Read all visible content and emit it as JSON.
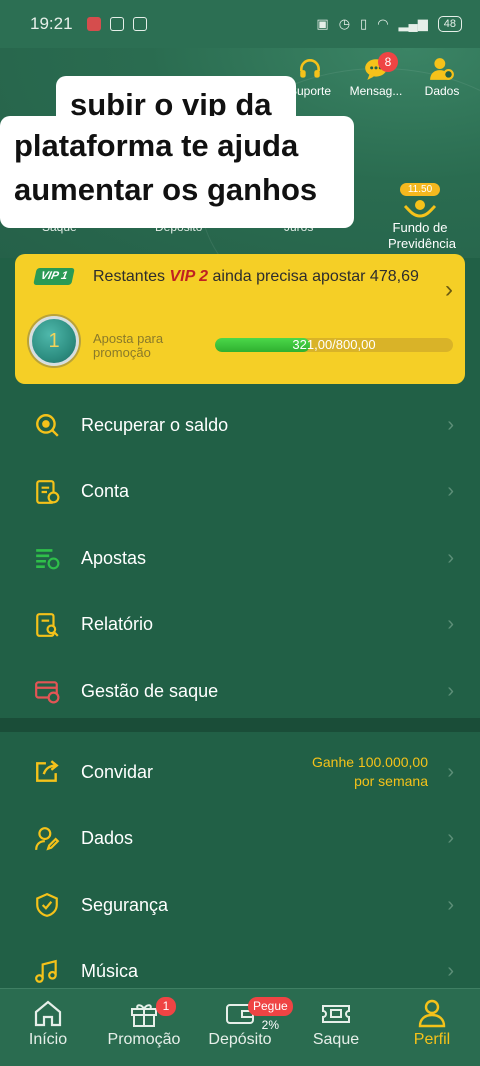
{
  "status_bar": {
    "time": "19:21",
    "battery": "48"
  },
  "header": {
    "actions": [
      {
        "label": "Suporte",
        "icon": "headset-icon"
      },
      {
        "label": "Mensag...",
        "icon": "chat-bubble-icon",
        "badge": "8"
      },
      {
        "label": "Dados",
        "icon": "user-settings-icon"
      }
    ],
    "quick_links": [
      "Saque",
      "Depósito",
      "Juros"
    ],
    "fundo": {
      "pill": "11.50",
      "label": "Fundo de Previdência"
    }
  },
  "overlay_caption": [
    "subir o vip da",
    "plataforma te ajuda",
    "aumentar os ganhos"
  ],
  "vip": {
    "tag": "VIP 1",
    "text_prefix": "Restantes",
    "next_level": "VIP 2",
    "text_suffix": "ainda precisa apostar 478,69",
    "level": "1",
    "promo_label": "Aposta para promoção",
    "progress_text": "321,00/800,00",
    "progress_fraction": 0.40125
  },
  "menu_group_1": [
    {
      "label": "Recuperar o saldo",
      "icon": "coin-refresh-icon"
    },
    {
      "label": "Conta",
      "icon": "account-document-icon"
    },
    {
      "label": "Apostas",
      "icon": "bet-list-icon"
    },
    {
      "label": "Relatório",
      "icon": "report-search-icon"
    },
    {
      "label": "Gestão de saque",
      "icon": "card-withdraw-icon"
    }
  ],
  "menu_group_2": [
    {
      "label": "Convidar",
      "icon": "share-icon",
      "promo_line1": "Ganhe 100.000,00",
      "promo_line2": "por semana"
    },
    {
      "label": "Dados",
      "icon": "user-edit-icon"
    },
    {
      "label": "Segurança",
      "icon": "shield-check-icon"
    },
    {
      "label": "Música",
      "icon": "music-note-icon"
    }
  ],
  "tabbar": {
    "tabs": [
      {
        "label": "Início",
        "icon": "home-icon"
      },
      {
        "label": "Promoção",
        "icon": "gift-icon",
        "badge": "1"
      },
      {
        "label": "Depósito",
        "icon": "wallet-icon",
        "badge": "Pegue 2%"
      },
      {
        "label": "Saque",
        "icon": "ticket-icon"
      },
      {
        "label": "Perfil",
        "icon": "profile-icon"
      }
    ],
    "active": "Perfil"
  },
  "colors": {
    "bg": "#216046",
    "accent": "#f5c21a",
    "card": "#f5cf26",
    "badge": "#ef4444"
  }
}
